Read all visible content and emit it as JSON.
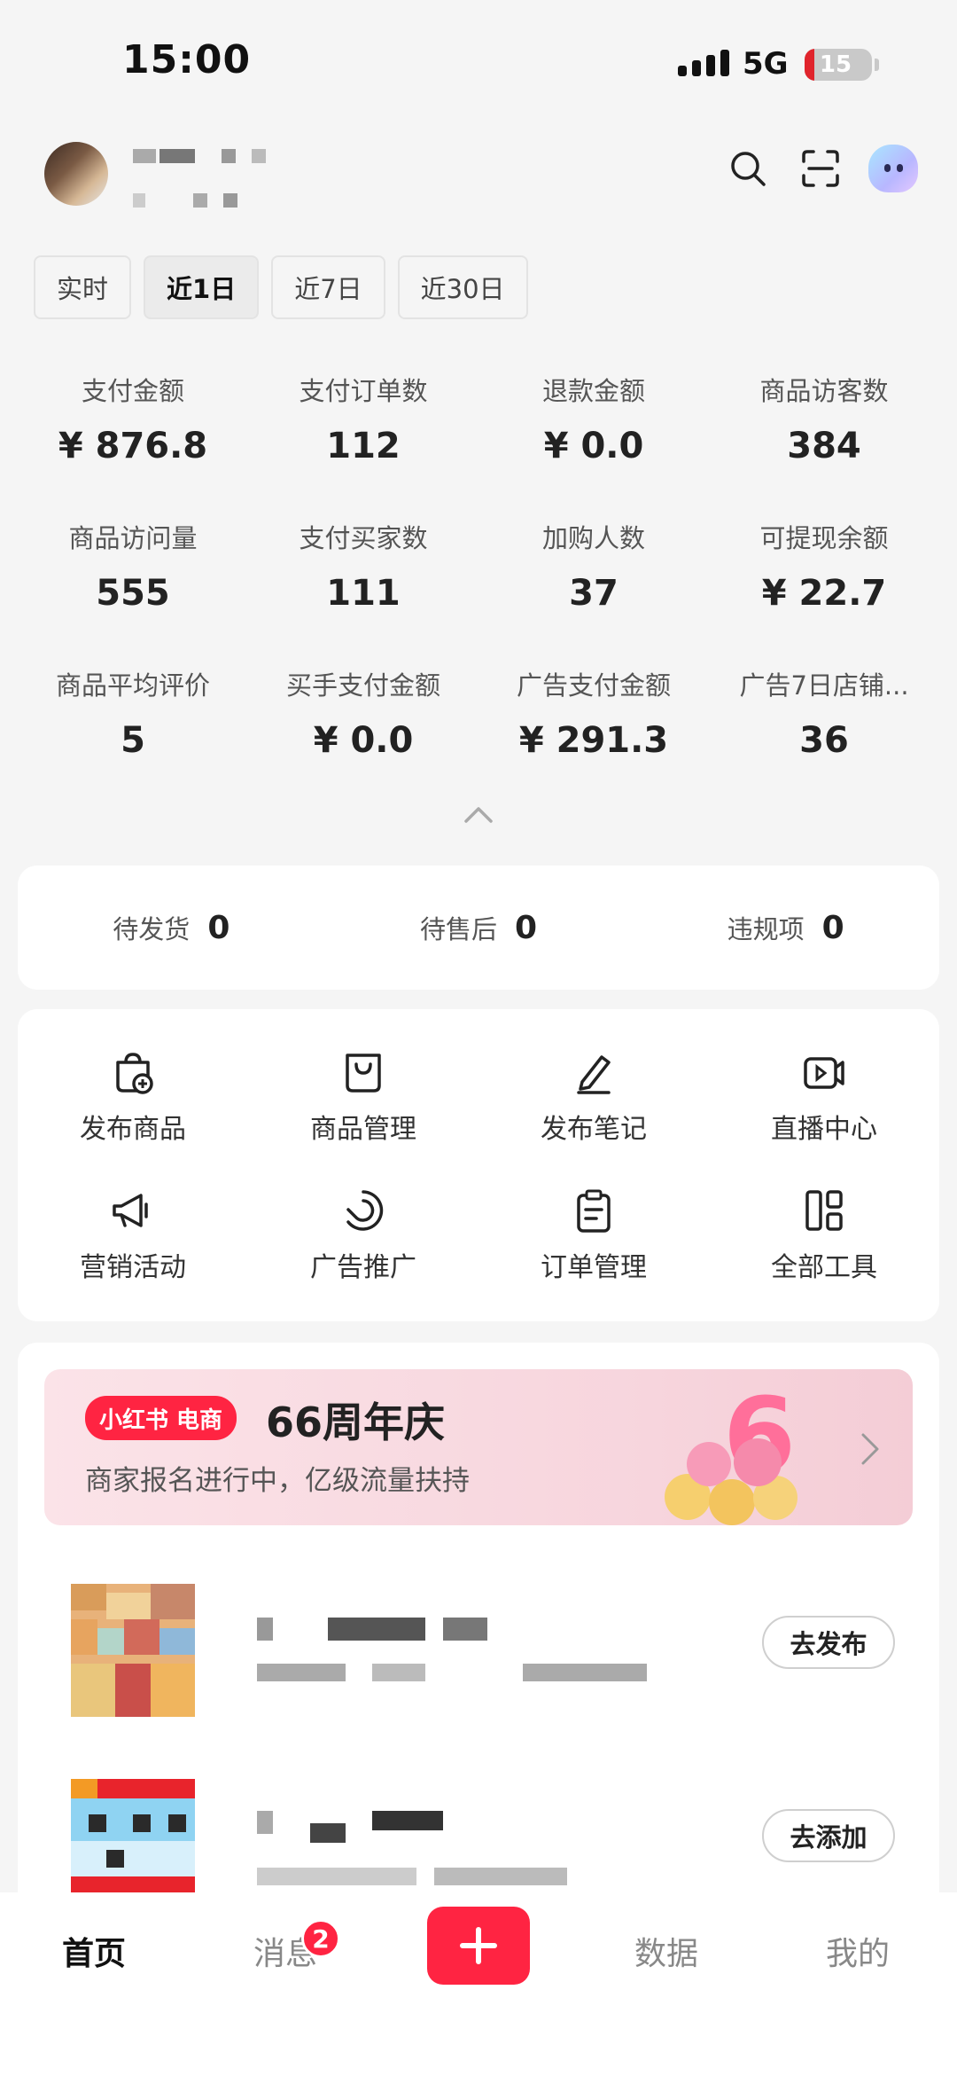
{
  "status": {
    "time": "15:00",
    "network": "5G",
    "battery": "15",
    "battery_level": 0.15
  },
  "header": {
    "icons": [
      "search-icon",
      "scan-icon",
      "assistant-mascot-icon"
    ]
  },
  "periods": [
    "实时",
    "近1日",
    "近7日",
    "近30日"
  ],
  "active_period": "近1日",
  "metrics": [
    {
      "label": "支付金额",
      "value": "¥ 876.8"
    },
    {
      "label": "支付订单数",
      "value": "112"
    },
    {
      "label": "退款金额",
      "value": "¥ 0.0"
    },
    {
      "label": "商品访客数",
      "value": "384"
    },
    {
      "label": "商品访问量",
      "value": "555"
    },
    {
      "label": "支付买家数",
      "value": "111"
    },
    {
      "label": "加购人数",
      "value": "37"
    },
    {
      "label": "可提现余额",
      "value": "¥ 22.7"
    },
    {
      "label": "商品平均评价",
      "value": "5"
    },
    {
      "label": "买手支付金额",
      "value": "¥ 0.0"
    },
    {
      "label": "广告支付金额",
      "value": "¥ 291.3"
    },
    {
      "label": "广告7日店铺...",
      "value": "36"
    }
  ],
  "pending": [
    {
      "label": "待发货",
      "value": "0"
    },
    {
      "label": "待售后",
      "value": "0"
    },
    {
      "label": "违规项",
      "value": "0"
    }
  ],
  "tools": [
    {
      "label": "发布商品",
      "icon": "publish-product-icon"
    },
    {
      "label": "商品管理",
      "icon": "bag-icon"
    },
    {
      "label": "发布笔记",
      "icon": "pen-icon"
    },
    {
      "label": "直播中心",
      "icon": "video-icon"
    },
    {
      "label": "营销活动",
      "icon": "megaphone-icon"
    },
    {
      "label": "广告推广",
      "icon": "promotion-icon"
    },
    {
      "label": "订单管理",
      "icon": "clipboard-icon"
    },
    {
      "label": "全部工具",
      "icon": "grid-icon"
    }
  ],
  "banner": {
    "brand": "小红书 电商",
    "title": "66周年庆",
    "subtitle": "商家报名进行中，亿级流量扶持"
  },
  "tasks": [
    {
      "button": "去发布"
    },
    {
      "button": "去添加"
    }
  ],
  "nav": {
    "home": "首页",
    "messages": "消息",
    "messages_badge": "2",
    "data": "数据",
    "mine": "我的"
  },
  "colors": {
    "brand_red": "#ff2442",
    "background": "#f5f5f5"
  }
}
